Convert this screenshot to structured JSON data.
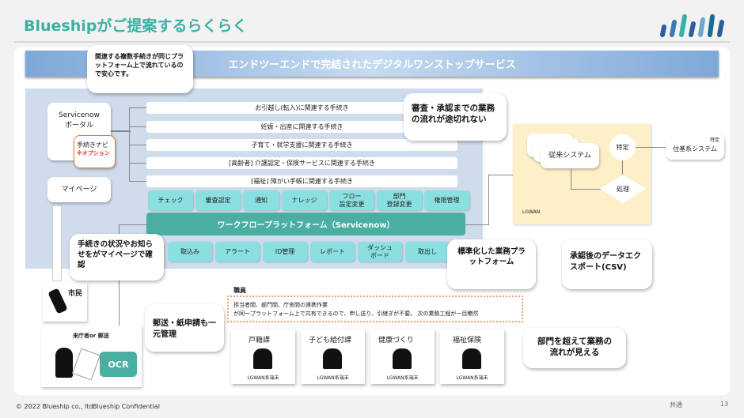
{
  "header": {
    "title": "Blueshipがご提案するらくらく",
    "logo": "blueship-logo"
  },
  "banner": "エンドツーエンドで完結されたデジタルワンストップサービス",
  "callouts": {
    "top": "関連する複数手続きが同じプラットフォーム上で流れているので安心です。",
    "review": "審査・承認までの業務の流れが途切れない",
    "mypage": "手続きの状況やお知らせをがマイページで確認",
    "standard": "標準化した業務プラットフォーム",
    "export": "承認後のデータエクスポート(CSV)",
    "mail": "郵送・紙申請も一元管理",
    "dept": "部門を超えて業務の流れが見える"
  },
  "portal": {
    "label1": "Servicenow",
    "label2": "ポータル",
    "navi": "手続きナビ",
    "option": "※オプション",
    "mypage": "マイページ"
  },
  "procedures": [
    "お引越し(転入)に関連する手続き",
    "妊娠・出産に関連する手続き",
    "子育て・就学支援に関連する手続き",
    "[高齢者] 介護認定・保険サービスに関連する手続き",
    "[福祉] 障がい手帳に関連する手続き"
  ],
  "top_chips": [
    "チェック",
    "審査認定",
    "通知",
    "ナレッジ",
    "フロー\n設定変更",
    "部門\n登録変更",
    "権限管理"
  ],
  "workflow": "ワークフロープラットフォーム（Servicenow）",
  "bottom_chips": [
    "取込み",
    "アラート",
    "ID管理",
    "レポート",
    "ダッシュ\nボード",
    "取出し"
  ],
  "lgwan": {
    "legacy": "従来システム",
    "tokutei": "特定",
    "shori": "処理",
    "label": "LGWAN",
    "jukisystem": "住基系システム",
    "jukisystem_tag": "特定"
  },
  "citizen": {
    "label": "市民",
    "visitor": "来庁者or 郵送",
    "ocr": "OCR"
  },
  "staff": {
    "label": "職員",
    "note1": "担当者間、部門間、庁舎間の連携作業",
    "note2": "が同一プラットフォーム上で共有できるので、申し送り、引継ぎが不要。 次の業務工程が一目瞭然",
    "depts": [
      {
        "name": "戸籍課",
        "terminal": "LGWAN系端末"
      },
      {
        "name": "子ども給付課",
        "terminal": "LGWAN系端末"
      },
      {
        "name": "健康づくり",
        "terminal": "LGWAN系端末"
      },
      {
        "name": "福祉保険",
        "terminal": "LGWAN系端末"
      }
    ]
  },
  "footer": {
    "copyright": "© 2022 Blueship co., ltd.",
    "confidential": "Blueship Confidential",
    "category": "共通",
    "page": "13"
  },
  "colors": {
    "accent": "#3cb0a4",
    "panel": "#cfdcec",
    "chip": "#8ae0e0",
    "workflow": "#4aaea2",
    "lgwan": "#fdf0c8",
    "option": "#e8792f"
  }
}
